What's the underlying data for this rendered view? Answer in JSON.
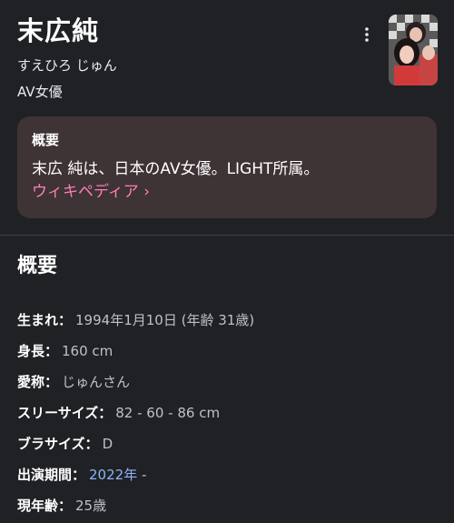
{
  "header": {
    "title": "末広純",
    "reading": "すえひろ じゅん",
    "category": "AV女優",
    "more_icon": "more-vert-icon",
    "thumbnail_alt": "profile-photo"
  },
  "summary": {
    "heading": "概要",
    "text": "末広 純は、日本のAV女優。LIGHT所属。",
    "link_label": "ウィキペディア ›"
  },
  "overview": {
    "heading": "概要",
    "facts": [
      {
        "label": "生まれ：",
        "value": "1994年1月10日 (年齢 31歳)"
      },
      {
        "label": "身長：",
        "value": "160 cm"
      },
      {
        "label": "愛称：",
        "value": "じゅんさん"
      },
      {
        "label": "スリーサイズ：",
        "value": "82 - 60 - 86 cm"
      },
      {
        "label": "ブラサイズ：",
        "value": "D"
      },
      {
        "label": "出演期間：",
        "value": "2022年",
        "tail": " -"
      },
      {
        "label": "現年齢：",
        "value": "25歳"
      }
    ]
  },
  "colors": {
    "background": "#202124",
    "card": "#3e3335",
    "link_pink": "#ff7eb6",
    "link_blue": "#8ab4f8"
  }
}
